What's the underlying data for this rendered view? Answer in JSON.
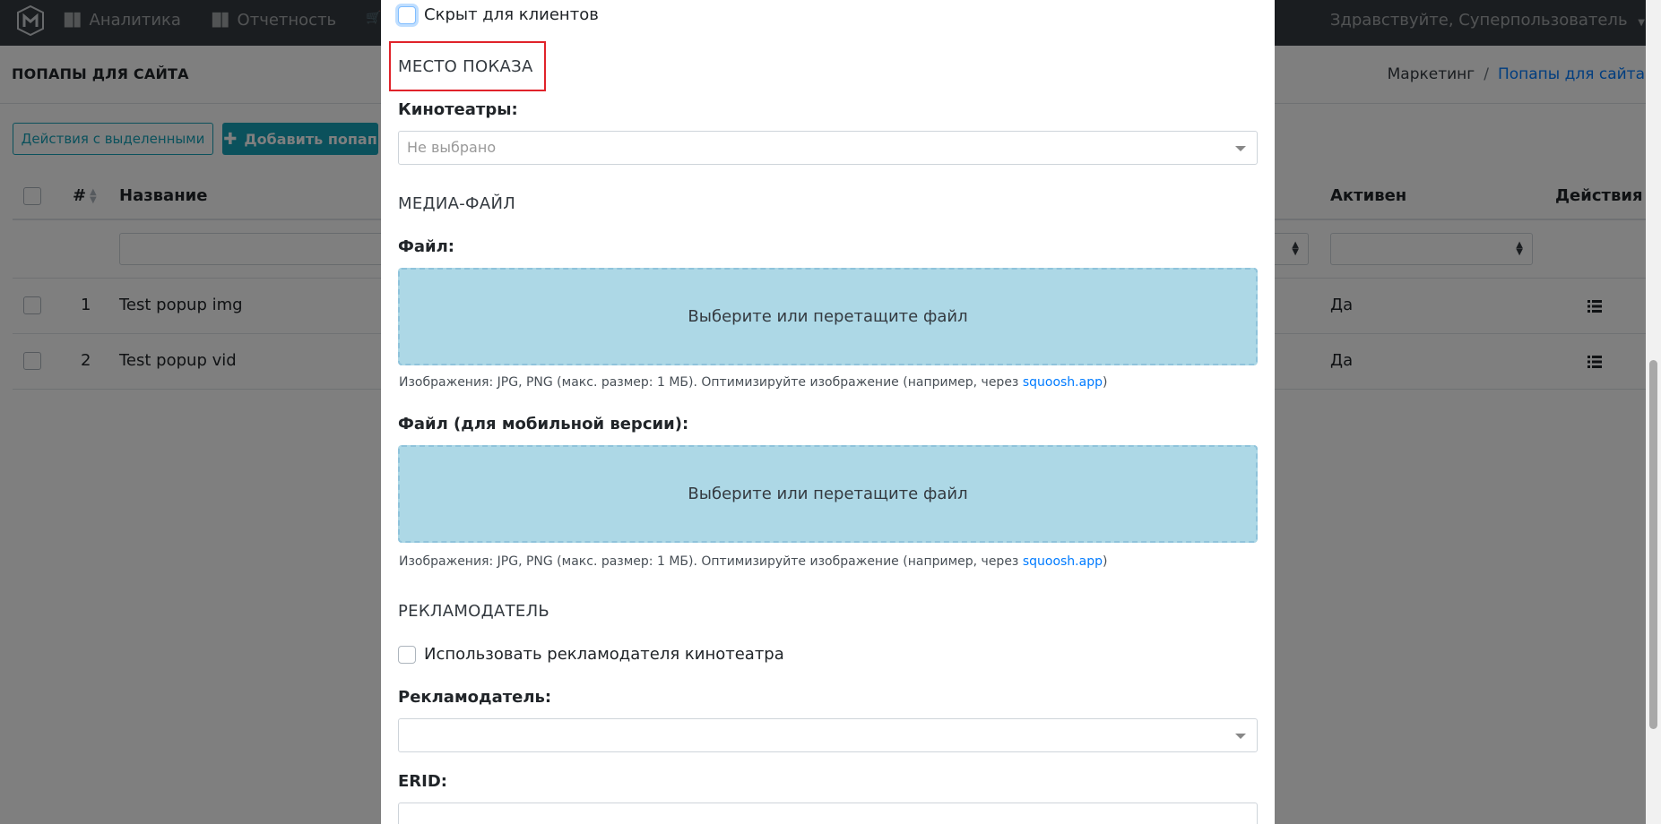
{
  "navbar": {
    "items": [
      {
        "label": "Аналитика",
        "icon": "bar-chart-icon"
      },
      {
        "label": "Отчетность",
        "icon": "bar-chart-icon"
      }
    ],
    "user_greeting": "Здравствуйте, Суперпользователь"
  },
  "page": {
    "title": "ПОПАПЫ ДЛЯ САЙТА",
    "breadcrumb": [
      "Маркетинг",
      "Попапы для сайта"
    ],
    "breadcrumb_sep": "/"
  },
  "toolbar": {
    "actions_label": "Действия с выделенными",
    "add_label": "Добавить попап"
  },
  "table": {
    "headers": {
      "num": "#",
      "name": "Название",
      "active": "Активен",
      "actions": "Действия"
    },
    "rows": [
      {
        "num": "1",
        "name": "Test popup img",
        "active": "Да"
      },
      {
        "num": "2",
        "name": "Test popup vid",
        "active": "Да"
      }
    ]
  },
  "modal": {
    "hidden_for_clients": "Скрыт для клиентов",
    "section_place": "МЕСТО ПОКАЗА",
    "cinemas_label": "Кинотеатры:",
    "cinemas_placeholder": "Не выбрано",
    "section_media": "МЕДИА-ФАЙЛ",
    "file_label": "Файл:",
    "dropzone_text": "Выберите или перетащите файл",
    "hint_text": "Изображения: JPG, PNG (макс. размер: 1 МБ). Оптимизируйте изображение (например, через ",
    "hint_link": "squoosh.app",
    "hint_close": ")",
    "mobile_file_label": "Файл (для мобильной версии):",
    "section_advertiser": "РЕКЛАМОДАТЕЛЬ",
    "use_cinema_advertiser": "Использовать рекламодателя кинотеатра",
    "advertiser_label": "Рекламодатель:",
    "erid_label": "ERID:"
  },
  "colors": {
    "navbar_bg": "#343a40",
    "accent": "#17a2b8",
    "dropzone_bg": "#add8e6",
    "highlight": "#e0232a",
    "link": "#007bff"
  }
}
